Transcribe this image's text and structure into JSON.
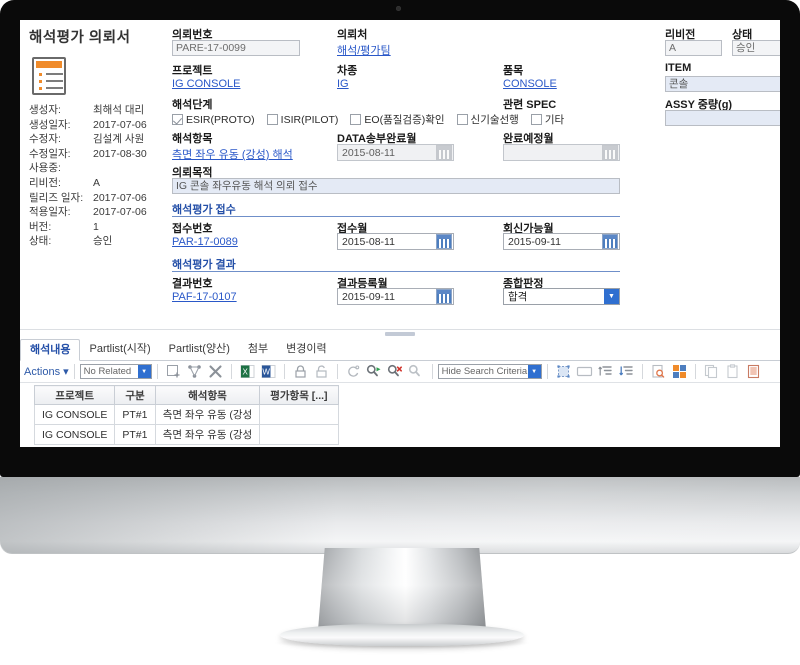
{
  "document": {
    "title": "해석평가 의뢰서",
    "icon": "document-list-icon"
  },
  "meta": {
    "rows": [
      {
        "key": "생성자:",
        "value": "최해석 대리"
      },
      {
        "key": "생성일자:",
        "value": "2017-07-06"
      },
      {
        "key": "수정자:",
        "value": "김설계 사원"
      },
      {
        "key": "수정일자:",
        "value": "2017-08-30"
      },
      {
        "key": "사용중:",
        "value": ""
      },
      {
        "key": "리비전:",
        "value": "A"
      },
      {
        "key": "릴리즈 일자:",
        "value": "2017-07-06"
      },
      {
        "key": "적용일자:",
        "value": "2017-07-06"
      },
      {
        "key": "버전:",
        "value": "1"
      },
      {
        "key": "상태:",
        "value": "승인"
      }
    ]
  },
  "form": {
    "request_no_label": "의뢰번호",
    "request_no_value": "PARE-17-0099",
    "client_label": "의뢰처",
    "client_value": "해석/평가팀",
    "project_label": "프로젝트",
    "project_value": "IG CONSOLE",
    "vehicle_label": "차종",
    "vehicle_value": "IG",
    "item_label": "품목",
    "item_value": "CONSOLE",
    "revision_label": "리비전",
    "revision_value": "A",
    "status_label": "상태",
    "status_value": "승인",
    "item_en_label": "ITEM",
    "item_en_value": "콘솔",
    "assy_weight_label": "ASSY 중량(g)",
    "assy_weight_value": "",
    "related_spec_label": "관련 SPEC",
    "stage_label": "해석단계",
    "stage_options": [
      {
        "label": "ESIR(PROTO)",
        "checked": true
      },
      {
        "label": "ISIR(PILOT)",
        "checked": false
      },
      {
        "label": "EO(품질검증)확인",
        "checked": false
      },
      {
        "label": "신기술선행",
        "checked": false
      },
      {
        "label": "기타",
        "checked": false
      }
    ],
    "analysis_item_label": "해석항목",
    "analysis_item_value": "측면 좌우 유동 (강성) 해석",
    "data_send_done_label": "DATA송부완료월",
    "data_send_done_value": "2015-08-11",
    "complete_due_label": "완료예정월",
    "complete_due_value": "",
    "purpose_label": "의뢰목적",
    "purpose_value": "IG 콘솔 좌우유동 해석 의뢰 접수"
  },
  "reception": {
    "section_title": "해석평가 접수",
    "no_label": "접수번호",
    "no_value": "PAR-17-0089",
    "date_label": "접수월",
    "date_value": "2015-08-11",
    "reply_label": "회신가능월",
    "reply_value": "2015-09-11"
  },
  "result": {
    "section_title": "해석평가 결과",
    "no_label": "결과번호",
    "no_value": "PAF-17-0107",
    "date_label": "결과등록월",
    "date_value": "2015-09-11",
    "verdict_label": "종합판정",
    "verdict_value": "합격"
  },
  "tabs": [
    {
      "label": "해석내용",
      "active": true
    },
    {
      "label": "Partlist(시작)",
      "active": false
    },
    {
      "label": "Partlist(양산)",
      "active": false
    },
    {
      "label": "첨부",
      "active": false
    },
    {
      "label": "변경이력",
      "active": false
    }
  ],
  "toolbar": {
    "actions_label": "Actions ▾",
    "relation_select_value": "No Related",
    "search_criteria_label": "Hide Search Criteria",
    "icons": [
      "add-icon",
      "relations-icon",
      "delete-icon",
      "excel-export-icon",
      "word-export-icon",
      "lock-icon",
      "unlock-icon",
      "refresh-icon",
      "search-run-icon",
      "search-clear-icon",
      "search-disabled-icon",
      "select-all-icon",
      "clear-selection-icon",
      "sort-ascending-icon",
      "sort-descending-icon",
      "find-in-page-icon",
      "expand-grid-icon",
      "copy-icon",
      "paste-icon",
      "report-icon"
    ]
  },
  "grid": {
    "columns": [
      "프로젝트",
      "구분",
      "해석항목",
      "평가항목 [...]"
    ],
    "rows": [
      {
        "project": "IG CONSOLE",
        "division": "PT#1",
        "analysis_item": "측면 좌우 유동 (강성",
        "eval_item": ""
      },
      {
        "project": "IG CONSOLE",
        "division": "PT#1",
        "analysis_item": "측면 좌우 유동 (강성",
        "eval_item": ""
      }
    ]
  },
  "colors": {
    "accent_blue": "#2550a8",
    "link_blue": "#2a58c8",
    "orange": "#f08b2a",
    "bezel": "#0a0a0a"
  }
}
